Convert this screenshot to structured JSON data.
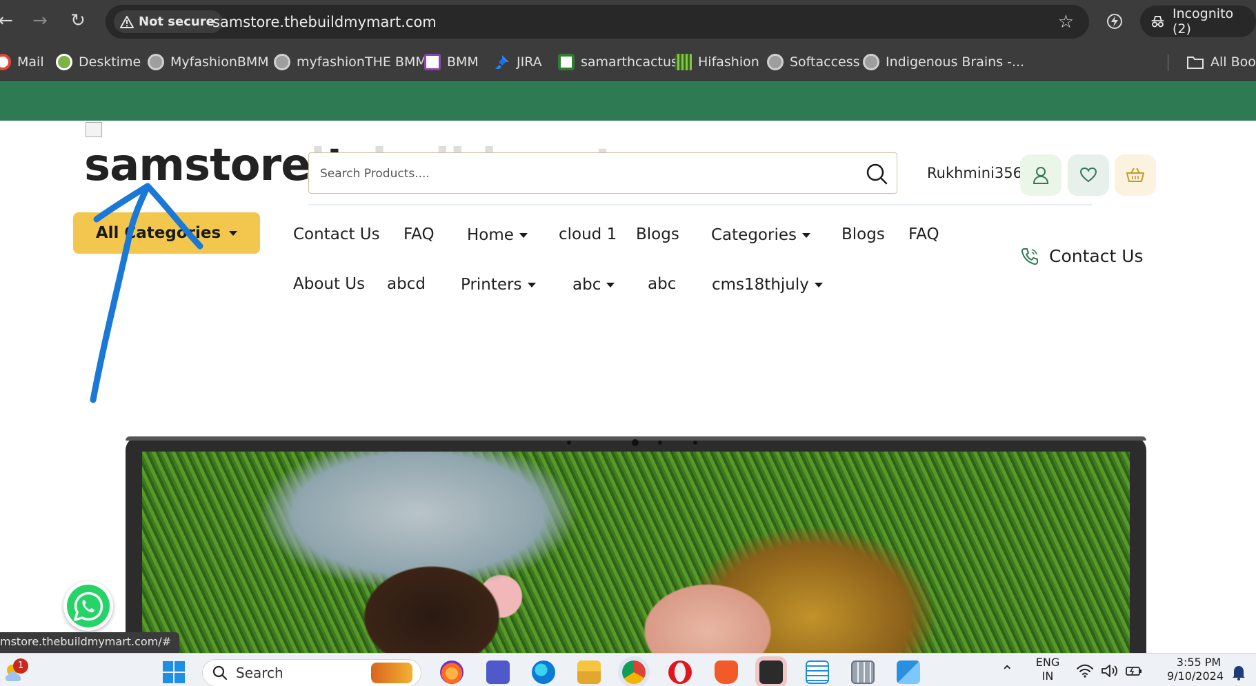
{
  "browser": {
    "security_label": "Not secure",
    "url": "samstore.thebuildmymart.com",
    "incognito_label": "Incognito (2)"
  },
  "bookmarks": [
    {
      "label": "Mail",
      "icon": "gmail-icon",
      "color": "#ea4335"
    },
    {
      "label": "Desktime",
      "icon": "desktime-icon",
      "color": "#7cb342"
    },
    {
      "label": "MyfashionBMM",
      "icon": "globe-icon",
      "color": "#bdbdbd"
    },
    {
      "label": "myfashionTHE BMM",
      "icon": "globe-icon",
      "color": "#bdbdbd"
    },
    {
      "label": "BMM",
      "icon": "bmm-icon",
      "color": "#8e44ad"
    },
    {
      "label": "JIRA",
      "icon": "jira-icon",
      "color": "#2684ff"
    },
    {
      "label": "samarthcactus",
      "icon": "cactus-icon",
      "color": "#2e7d32"
    },
    {
      "label": "Hifashion",
      "icon": "hifashion-icon",
      "color": "#33691e"
    },
    {
      "label": "Softaccess",
      "icon": "globe-icon",
      "color": "#bdbdbd"
    },
    {
      "label": "Indigenous Brains -...",
      "icon": "globe-icon",
      "color": "#bdbdbd"
    }
  ],
  "bookmarks_folder": "All Book",
  "site": {
    "logo_text": "samstore.t",
    "logo_overflow": "hebuildmart",
    "search_placeholder": "Search Products....",
    "username": "Rukhmini356",
    "all_categories": "All Categories",
    "menu_row1": [
      {
        "label": "Contact Us",
        "dropdown": false
      },
      {
        "label": "FAQ",
        "dropdown": false
      },
      {
        "label": "Home",
        "dropdown": true
      },
      {
        "label": "cloud 1",
        "dropdown": false
      },
      {
        "label": "Blogs",
        "dropdown": false
      },
      {
        "label": "Categories",
        "dropdown": true
      },
      {
        "label": "Blogs",
        "dropdown": false
      },
      {
        "label": "FAQ",
        "dropdown": false
      }
    ],
    "menu_row2": [
      {
        "label": "About Us",
        "dropdown": false
      },
      {
        "label": "abcd",
        "dropdown": false
      },
      {
        "label": "Printers",
        "dropdown": true
      },
      {
        "label": "abc",
        "dropdown": true
      },
      {
        "label": "abc",
        "dropdown": false
      },
      {
        "label": "cms18thjuly",
        "dropdown": true
      }
    ],
    "contact_right": "Contact Us",
    "brand_green": "#2e7a52",
    "accent_yellow": "#f3c64e"
  },
  "status_bar_url": "mstore.thebuildmymart.com/#",
  "taskbar": {
    "search_label": "Search",
    "weather_badge": "1",
    "language": "ENG",
    "region": "IN",
    "time": "3:55 PM",
    "date": "9/10/2024"
  }
}
